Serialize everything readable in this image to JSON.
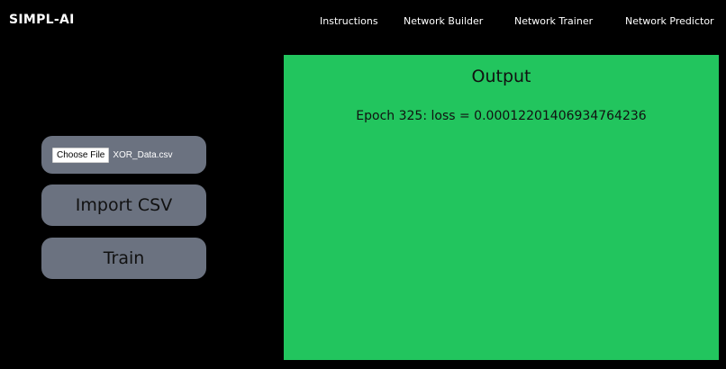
{
  "header": {
    "brand": "SIMPL-AI",
    "nav": [
      {
        "label": "Instructions"
      },
      {
        "label": "Network Builder"
      },
      {
        "label": "Network Trainer"
      },
      {
        "label": "Network Predictor"
      }
    ]
  },
  "controls": {
    "choose_file_label": "Choose File",
    "file_name": "XOR_Data.csv",
    "import_label": "Import CSV",
    "train_label": "Train"
  },
  "output": {
    "title": "Output",
    "message": "Epoch 325: loss = 0.00012201406934764236"
  },
  "colors": {
    "background": "#000000",
    "button": "#6b7280",
    "output_panel": "#22c55e"
  }
}
